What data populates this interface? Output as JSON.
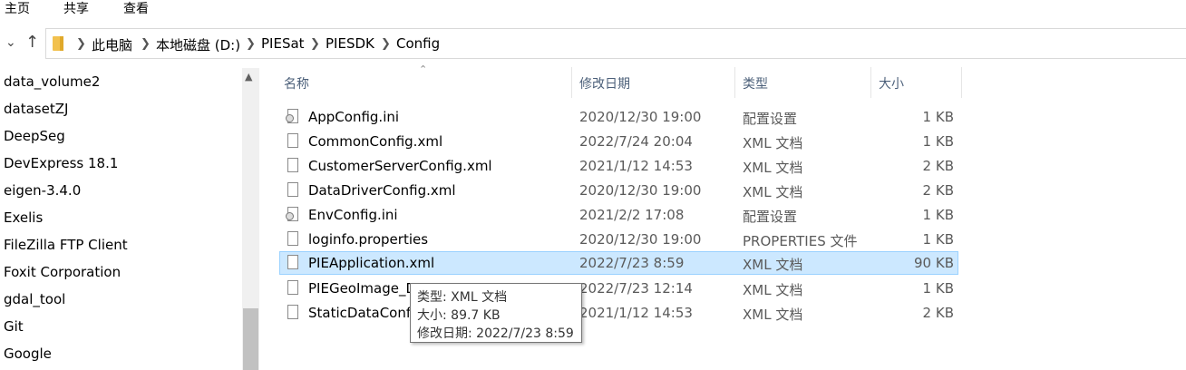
{
  "ribbon": {
    "tabs": [
      "主页",
      "共享",
      "查看"
    ]
  },
  "address": {
    "crumbs": [
      "此电脑",
      "本地磁盘 (D:)",
      "PIESat",
      "PIESDK",
      "Config"
    ]
  },
  "sidebar": {
    "items": [
      "data_volume2",
      "datasetZJ",
      "DeepSeg",
      "DevExpress 18.1",
      "eigen-3.4.0",
      "Exelis",
      "FileZilla FTP Client",
      "Foxit Corporation",
      "gdal_tool",
      "Git",
      "Google"
    ]
  },
  "columns": {
    "name": "名称",
    "date": "修改日期",
    "type": "类型",
    "size": "大小"
  },
  "files": [
    {
      "name": "AppConfig.ini",
      "date": "2020/12/30 19:00",
      "type": "配置设置",
      "size": "1 KB",
      "icon": "ini-settings-file-icon"
    },
    {
      "name": "CommonConfig.xml",
      "date": "2022/7/24 20:04",
      "type": "XML 文档",
      "size": "1 KB",
      "icon": "document-file-icon"
    },
    {
      "name": "CustomerServerConfig.xml",
      "date": "2021/1/12 14:53",
      "type": "XML 文档",
      "size": "2 KB",
      "icon": "document-file-icon"
    },
    {
      "name": "DataDriverConfig.xml",
      "date": "2020/12/30 19:00",
      "type": "XML 文档",
      "size": "2 KB",
      "icon": "document-file-icon"
    },
    {
      "name": "EnvConfig.ini",
      "date": "2021/2/2 17:08",
      "type": "配置设置",
      "size": "1 KB",
      "icon": "ini-settings-file-icon"
    },
    {
      "name": "loginfo.properties",
      "date": "2020/12/30 19:00",
      "type": "PROPERTIES 文件",
      "size": "1 KB",
      "icon": "document-file-icon"
    },
    {
      "name": "PIEApplication.xml",
      "date": "2022/7/23 8:59",
      "type": "XML 文档",
      "size": "90 KB",
      "icon": "document-file-icon"
    },
    {
      "name": "PIEGeoImage_D",
      "date": "2022/7/23 12:14",
      "type": "XML 文档",
      "size": "1 KB",
      "icon": "document-file-icon"
    },
    {
      "name": "StaticDataConfi",
      "date": "2021/1/12 14:53",
      "type": "XML 文档",
      "size": "2 KB",
      "icon": "document-file-icon"
    }
  ],
  "selected_index": 6,
  "tooltip": {
    "type_line": "类型: XML 文档",
    "size_line": "大小: 89.7 KB",
    "date_line": "修改日期: 2022/7/23 8:59"
  },
  "colors": {
    "selection_bg": "#cce8ff",
    "selection_border": "#99d1ff",
    "header_text": "#4c607a",
    "folder": "#f2c14e"
  }
}
